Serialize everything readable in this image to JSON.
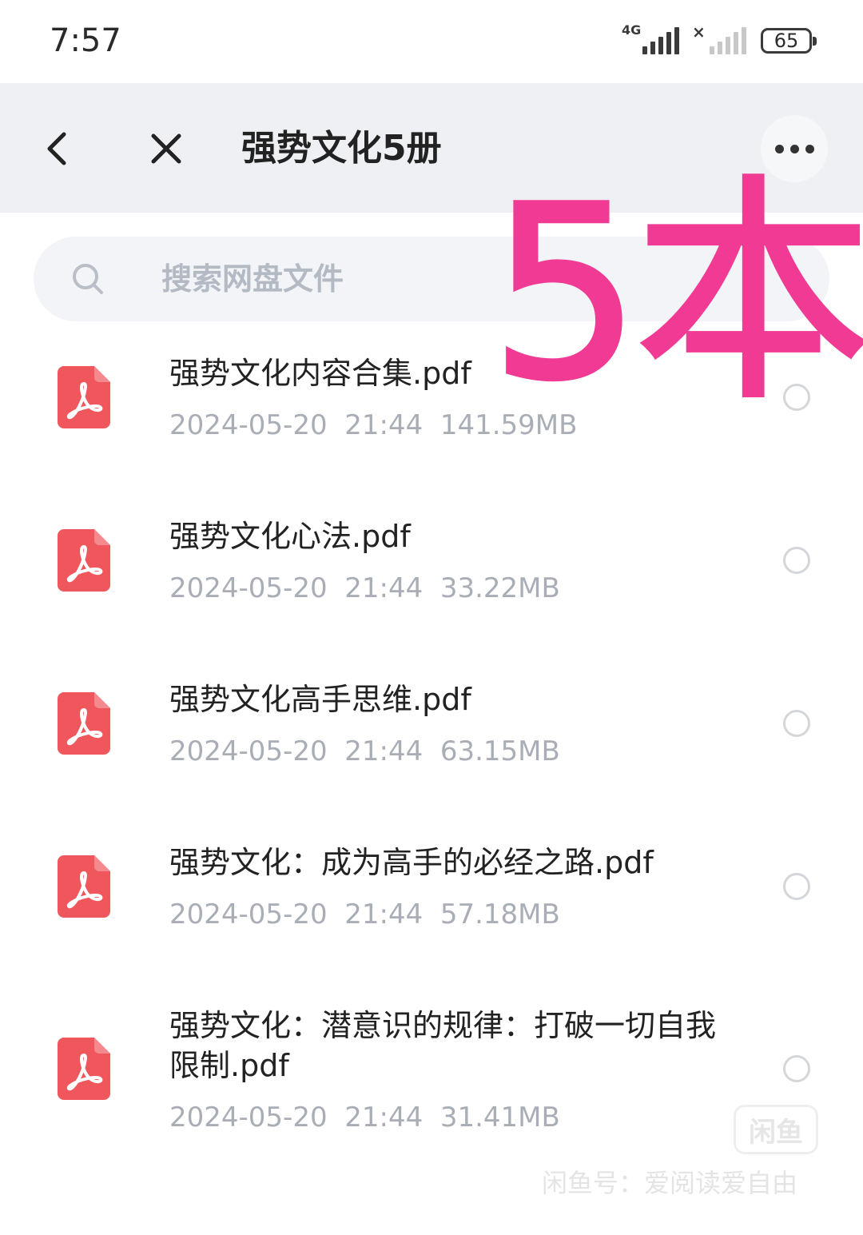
{
  "status_bar": {
    "time": "7:57",
    "network_label": "4G",
    "battery": "65"
  },
  "header": {
    "title": "强势文化5册"
  },
  "search": {
    "placeholder": "搜索网盘文件"
  },
  "files": [
    {
      "name": "强势文化内容合集.pdf",
      "date": "2024-05-20",
      "time": "21:44",
      "size": "141.59MB"
    },
    {
      "name": "强势文化心法.pdf",
      "date": "2024-05-20",
      "time": "21:44",
      "size": "33.22MB"
    },
    {
      "name": "强势文化高手思维.pdf",
      "date": "2024-05-20",
      "time": "21:44",
      "size": "63.15MB"
    },
    {
      "name": "强势文化：成为高手的必经之路.pdf",
      "date": "2024-05-20",
      "time": "21:44",
      "size": "57.18MB"
    },
    {
      "name": "强势文化：潜意识的规律：打破一切自我限制.pdf",
      "date": "2024-05-20",
      "time": "21:44",
      "size": "31.41MB"
    }
  ],
  "overlay": {
    "annotation": "5本"
  },
  "watermark": {
    "logo": "闲鱼",
    "text": "闲鱼号：爱阅读爱自由"
  },
  "colors": {
    "accent_pink": "#f03a93",
    "pdf_red": "#f0575c",
    "header_bg": "#eef0f3"
  },
  "icons": {
    "back": "chevron-left-icon",
    "close": "close-icon",
    "more": "more-dots-icon",
    "search": "search-icon",
    "file": "pdf-file-icon"
  }
}
